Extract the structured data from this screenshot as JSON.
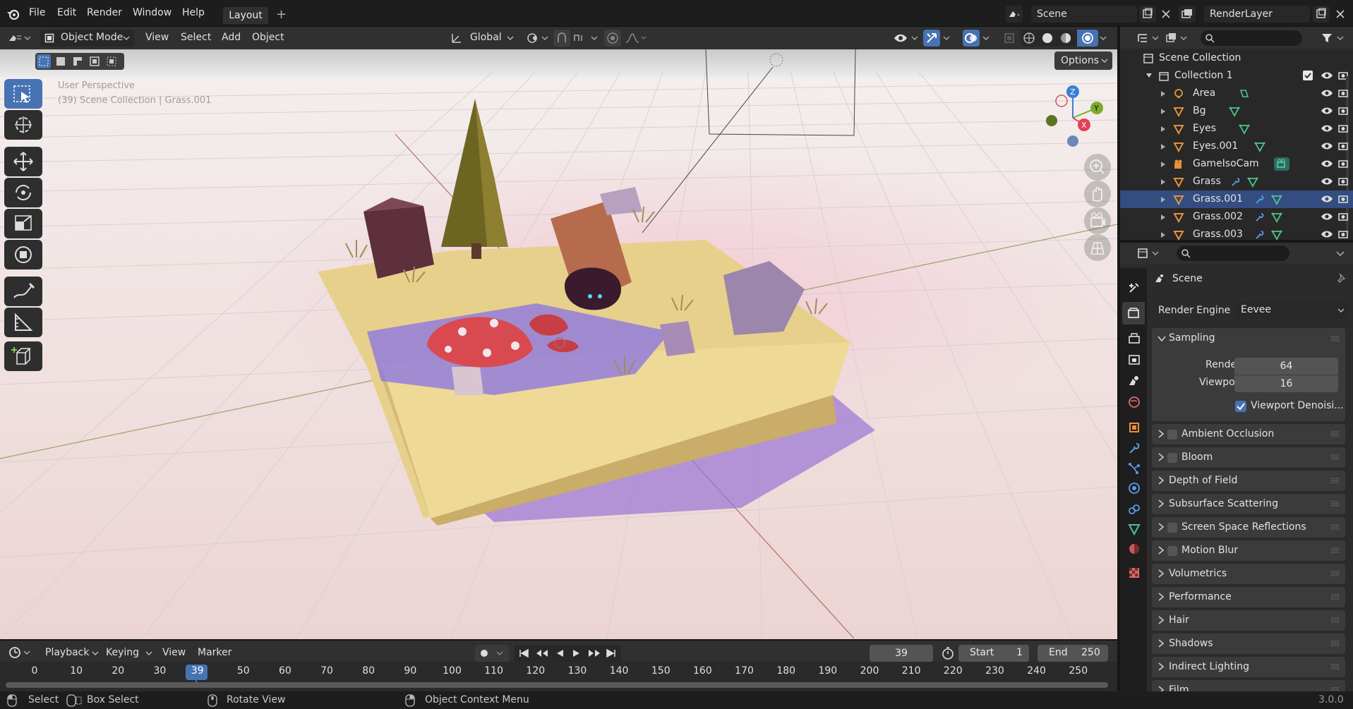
{
  "app": {
    "version": "3.0.0"
  },
  "menu": [
    "File",
    "Edit",
    "Render",
    "Window",
    "Help"
  ],
  "workspace_tab": "Layout",
  "scene_field": "Scene",
  "view_layer_field": "RenderLayer",
  "viewport_header": {
    "mode": "Object Mode",
    "menus": [
      "View",
      "Select",
      "Add",
      "Object"
    ],
    "orientation": "Global",
    "options_label": "Options"
  },
  "viewport": {
    "perspective": "User Perspective",
    "context": "(39) Scene Collection | Grass.001",
    "gizmo_axes": [
      "Z",
      "Y",
      "X"
    ]
  },
  "outliner": {
    "root": "Scene Collection",
    "collection": "Collection 1",
    "items": [
      {
        "name": "Area",
        "selected": false
      },
      {
        "name": "Bg",
        "selected": false
      },
      {
        "name": "Eyes",
        "selected": false
      },
      {
        "name": "Eyes.001",
        "selected": false
      },
      {
        "name": "GameIsoCam",
        "selected": false
      },
      {
        "name": "Grass",
        "selected": false
      },
      {
        "name": "Grass.001",
        "selected": true
      },
      {
        "name": "Grass.002",
        "selected": false
      },
      {
        "name": "Grass.003",
        "selected": false
      }
    ]
  },
  "properties": {
    "context_title": "Scene",
    "render_engine_label": "Render Engine",
    "render_engine_value": "Eevee",
    "sampling": {
      "title": "Sampling",
      "render_label": "Render",
      "render_value": "64",
      "viewport_label": "Viewport",
      "viewport_value": "16",
      "denoise_label": "Viewport Denoisi...",
      "denoise_checked": true
    },
    "panels": [
      {
        "label": "Ambient Occlusion",
        "checkbox": true
      },
      {
        "label": "Bloom",
        "checkbox": true
      },
      {
        "label": "Depth of Field",
        "checkbox": false
      },
      {
        "label": "Subsurface Scattering",
        "checkbox": false
      },
      {
        "label": "Screen Space Reflections",
        "checkbox": true
      },
      {
        "label": "Motion Blur",
        "checkbox": true
      },
      {
        "label": "Volumetrics",
        "checkbox": false
      },
      {
        "label": "Performance",
        "checkbox": false
      },
      {
        "label": "Hair",
        "checkbox": false
      },
      {
        "label": "Shadows",
        "checkbox": false
      },
      {
        "label": "Indirect Lighting",
        "checkbox": false
      },
      {
        "label": "Film",
        "checkbox": false
      }
    ]
  },
  "timeline": {
    "menus": [
      "Playback",
      "Keying",
      "View",
      "Marker"
    ],
    "current_frame": "39",
    "start_label": "Start",
    "start_value": "1",
    "end_label": "End",
    "end_value": "250",
    "ruler": [
      "0",
      "10",
      "20",
      "30",
      "39",
      "50",
      "60",
      "70",
      "80",
      "90",
      "100",
      "110",
      "120",
      "130",
      "140",
      "150",
      "160",
      "170",
      "180",
      "190",
      "200",
      "210",
      "220",
      "230",
      "240",
      "250"
    ]
  },
  "statusbar": {
    "select": "Select",
    "box_select": "Box Select",
    "rotate_view": "Rotate View",
    "context_menu": "Object Context Menu"
  },
  "colors": {
    "accent": "#4772b3",
    "selected_row": "#334d80",
    "header": "#303030",
    "panel": "#3b3b3b"
  }
}
